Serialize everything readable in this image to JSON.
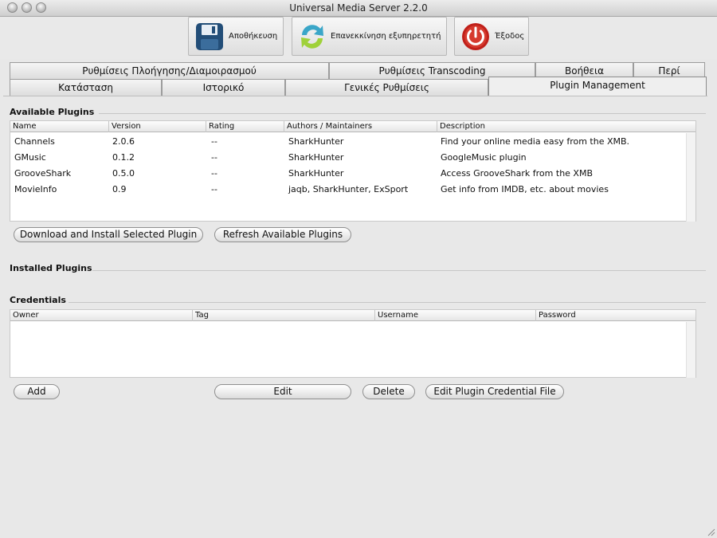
{
  "window": {
    "title": "Universal Media Server 2.2.0"
  },
  "toolbar": {
    "save_label": "Αποθήκευση",
    "restart_label": "Επανεκκίνηση εξυπηρετητή",
    "quit_label": "Έξοδος"
  },
  "tabs": {
    "row1": [
      "Ρυθμίσεις Πλοήγησης/Διαμοιρασμού",
      "Ρυθμίσεις Transcoding",
      "Βοήθεια",
      "Περί"
    ],
    "row2": [
      "Κατάσταση",
      "Ιστορικό",
      "Γενικές Ρυθμίσεις",
      "Plugin Management"
    ]
  },
  "available": {
    "title": "Available Plugins",
    "headers": [
      "Name",
      "Version",
      "Rating",
      "Authors / Maintainers",
      "Description"
    ],
    "rows": [
      [
        "Channels",
        "2.0.6",
        "--",
        "SharkHunter",
        "Find your online media easy from the XMB."
      ],
      [
        "GMusic",
        "0.1.2",
        "--",
        "SharkHunter",
        "GoogleMusic plugin"
      ],
      [
        "GrooveShark",
        "0.5.0",
        "--",
        "SharkHunter",
        "Access GrooveShark from the XMB"
      ],
      [
        "MovieInfo",
        "0.9",
        "--",
        "jaqb, SharkHunter, ExSport",
        "Get info from IMDB, etc. about movies"
      ]
    ],
    "download_label": "Download and Install Selected Plugin",
    "refresh_label": "Refresh Available Plugins"
  },
  "installed": {
    "title": "Installed Plugins"
  },
  "credentials": {
    "title": "Credentials",
    "headers": [
      "Owner",
      "Tag",
      "Username",
      "Password"
    ],
    "add_label": "Add",
    "edit_label": "Edit",
    "delete_label": "Delete",
    "edit_file_label": "Edit Plugin Credential File"
  },
  "icons": {
    "save": "floppy-disk-icon",
    "restart": "refresh-arrows-icon",
    "quit": "power-icon"
  },
  "colors": {
    "save_icon": "#234e78",
    "restart_icon": "#3aa6c8",
    "quit_icon": "#c0201a"
  }
}
